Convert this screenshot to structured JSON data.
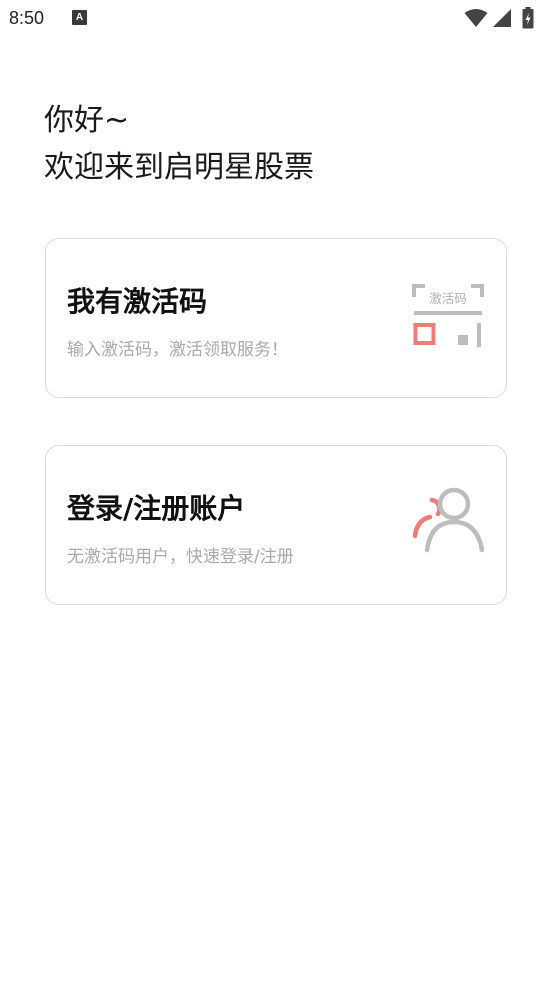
{
  "status_bar": {
    "time": "8:50",
    "notification_icon": "A",
    "icons": [
      "wifi-icon",
      "signal-icon",
      "battery-icon"
    ]
  },
  "greeting": {
    "line1": "你好~",
    "line2": "欢迎来到启明星股票"
  },
  "cards": [
    {
      "title": "我有激活码",
      "subtitle": "输入激活码，激活领取服务！",
      "icon": "activation-code-icon",
      "icon_text": "激活码"
    },
    {
      "title": "登录/注册账户",
      "subtitle": "无激活码用户，快速登录/注册",
      "icon": "user-account-icon"
    }
  ],
  "colors": {
    "accent": "#ef7b7b",
    "icon_gray": "#bdbdbd",
    "card_border": "#dcdcdc",
    "subtitle": "#a9a9a9"
  }
}
